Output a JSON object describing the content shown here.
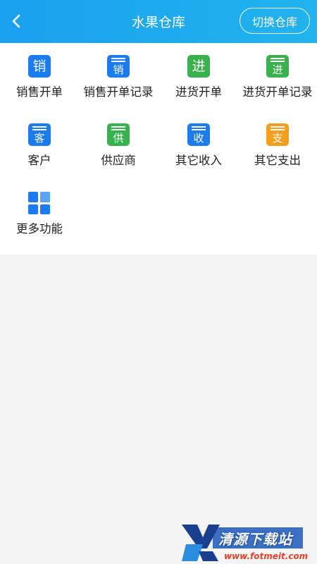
{
  "header": {
    "title": "水果仓库",
    "switch_label": "切换仓库",
    "back_icon": "chevron-left-icon"
  },
  "menu": {
    "items": [
      {
        "label": "销售开单",
        "glyph": "销",
        "color": "#1a7cf0",
        "style": "plain"
      },
      {
        "label": "销售开单记录",
        "glyph": "销",
        "color": "#1a7cf0",
        "style": "list"
      },
      {
        "label": "进货开单",
        "glyph": "进",
        "color": "#37b24d",
        "style": "plain"
      },
      {
        "label": "进货开单记录",
        "glyph": "进",
        "color": "#37b24d",
        "style": "list"
      },
      {
        "label": "客户",
        "glyph": "客",
        "color": "#1a7cf0",
        "style": "list"
      },
      {
        "label": "供应商",
        "glyph": "供",
        "color": "#37b24d",
        "style": "list"
      },
      {
        "label": "其它收入",
        "glyph": "收",
        "color": "#1a7cf0",
        "style": "list"
      },
      {
        "label": "其它支出",
        "glyph": "支",
        "color": "#f59f1e",
        "style": "list"
      },
      {
        "label": "更多功能",
        "glyph": "",
        "color": "#1a7cf0",
        "style": "grid"
      }
    ]
  },
  "watermark": {
    "text": "清源下载站",
    "url": "www.fotmeit.com"
  }
}
